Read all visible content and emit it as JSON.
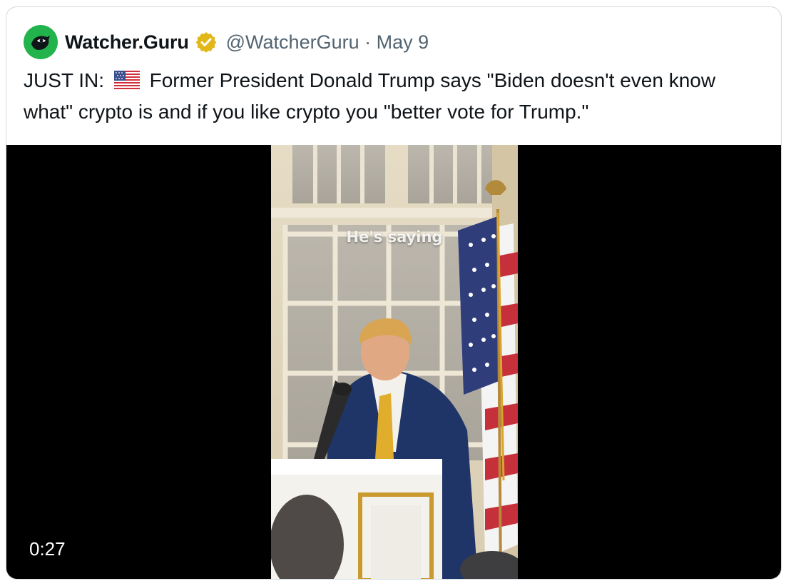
{
  "tweet": {
    "author_name": "Watcher.Guru",
    "handle_date": "@WatcherGuru · May 9",
    "text_prefix": "JUST IN:",
    "text_line1": "Former President Donald Trump says \"Biden doesn't even know",
    "text_line2": "what\" crypto is and if you like crypto you \"better vote for Trump.\"",
    "flag_icon": "us-flag-emoji",
    "verified_color": "#e2b719",
    "avatar_color": "#22b34c"
  },
  "media": {
    "caption": "He's saying",
    "duration": "0:27"
  }
}
